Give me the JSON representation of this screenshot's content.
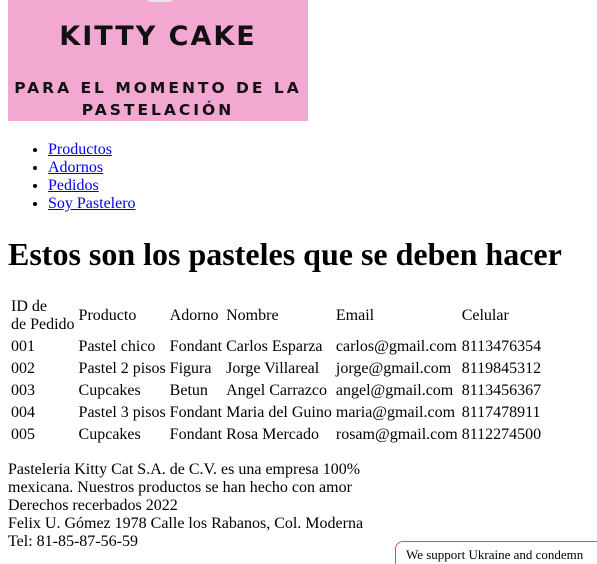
{
  "logo": {
    "title": "KITTY CAKE",
    "subtitle_line1": "PARA EL MOMENTO DE LA",
    "subtitle_line2": "PASTELACIÓN",
    "background": "#f2a8d1"
  },
  "nav": {
    "items": [
      {
        "label": "Productos"
      },
      {
        "label": "Adornos"
      },
      {
        "label": "Pedidos"
      },
      {
        "label": "Soy Pastelero"
      }
    ]
  },
  "heading": "Estos son los pasteles que se deben hacer",
  "table": {
    "headers": {
      "id_line1": "ID de",
      "id_line2": "de Pedido",
      "producto": "Producto",
      "adorno": "Adorno",
      "nombre": "Nombre",
      "email": "Email",
      "celular": "Celular"
    },
    "rows": [
      [
        "001",
        "Pastel chico",
        "Fondant",
        "Carlos Esparza",
        "carlos@gmail.com",
        "8113476354"
      ],
      [
        "002",
        "Pastel 2 pisos",
        "Figura",
        "Jorge Villareal",
        "jorge@gmail.com",
        "8119845312"
      ],
      [
        "003",
        "Cupcakes",
        "Betun",
        "Angel Carrazco",
        "angel@gmail.com",
        "8113456367"
      ],
      [
        "004",
        "Pastel 3 pisos",
        "Fondant",
        "Maria del Guino",
        "maria@gmail.com",
        "8117478911"
      ],
      [
        "005",
        "Cupcakes",
        "Fondant",
        "Rosa Mercado",
        "rosam@gmail.com",
        "8112274500"
      ]
    ]
  },
  "footer": {
    "line1": "Pasteleria Kitty Cat S.A. de C.V. es una empresa 100%",
    "line2": "mexicana. Nuestros productos se han hecho con amor",
    "line3": "Derechos recerbados 2022",
    "line4": "Felix U. Gómez 1978 Calle los Rabanos, Col. Moderna",
    "line5": "Tel: 81-85-87-56-59"
  },
  "banner": {
    "text": "We support Ukraine and condemn",
    "border_color": "#d9534f"
  }
}
